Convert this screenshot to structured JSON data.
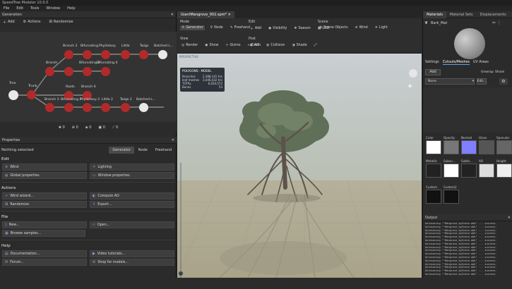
{
  "app": {
    "title": "SpeedTree Modeler 10.0.0"
  },
  "menu": [
    "File",
    "Edit",
    "Tools",
    "Window",
    "Help"
  ],
  "generation": {
    "title": "Generation",
    "tools": {
      "add": "Add",
      "actions": "Actions",
      "randomize": "Randomize"
    },
    "nodes": [
      {
        "label": "Tree"
      },
      {
        "label": "Trunk"
      },
      {
        "label": "Branch"
      },
      {
        "label": "Branch 2"
      },
      {
        "label": "Bifurcating"
      },
      {
        "label": "Phyllotaxy"
      },
      {
        "label": "Little"
      },
      {
        "label": "Twigs"
      },
      {
        "label": "Batched L..."
      },
      {
        "label": "Bifurcating 3"
      },
      {
        "label": "Bifurcating 4"
      },
      {
        "label": "Roots"
      },
      {
        "label": "Branch 4"
      },
      {
        "label": "Branch 3"
      },
      {
        "label": "Bifurcating 2"
      },
      {
        "label": "Phyllotaxy 2"
      },
      {
        "label": "Little 2"
      },
      {
        "label": "Twigs 2"
      },
      {
        "label": "Batched L..."
      }
    ],
    "stats": [
      "0",
      "0",
      "0",
      "0",
      "0"
    ]
  },
  "properties": {
    "title": "Properties",
    "nothing_selected": "Nothing selected",
    "modes": [
      "Generator",
      "Node",
      "Freehand"
    ],
    "sections": {
      "edit": "Edit",
      "actions": "Actions",
      "file": "File",
      "help": "Help"
    },
    "edit_buttons": [
      "Wind",
      "Lighting",
      "Global properties",
      "Window properties"
    ],
    "action_buttons": [
      "Wind wizard...",
      "Compute AO",
      "Randomize",
      "Export..."
    ],
    "file_buttons": [
      "New...",
      "Open...",
      "Browse samples..."
    ],
    "help_buttons": [
      "Documentation...",
      "Video tutorials...",
      "Forum...",
      "Shop for models..."
    ]
  },
  "document": {
    "tab": "GiantMangrove_002.spm*",
    "mode": {
      "label": "Mode",
      "items": [
        "Generator",
        "Node",
        "Freehand"
      ]
    },
    "edit": {
      "label": "Edit",
      "items": [
        "Add",
        "Visibility",
        "Season",
        "LOD"
      ]
    },
    "scene": {
      "label": "Scene",
      "items": [
        "Scene Objects",
        "Wind",
        "Light"
      ]
    },
    "view": {
      "label": "View",
      "items": [
        "Render",
        "Show",
        "Gizmo",
        "Zoom"
      ]
    },
    "post": {
      "label": "Post",
      "items": [
        "AO",
        "Collision",
        "Shade"
      ]
    },
    "perspective": "PERSPECTIVE",
    "stats": {
      "header": "POLYGONS · MODEL",
      "rows": [
        {
          "k": "Branches",
          "v": "2,388,141 tris"
        },
        {
          "k": "leaf meshes",
          "v": "3,446,432 tris"
        },
        {
          "k": "TOTAL",
          "v": "6,034,573"
        },
        {
          "k": "Bones",
          "v": "53"
        }
      ]
    }
  },
  "materials": {
    "tabs": [
      "Materials",
      "Material Sets",
      "Displacements"
    ],
    "name": "Bark_Mat",
    "subtabs": [
      "Settings",
      "Cutouts/Meshes",
      "UV Areas"
    ],
    "add": "Add",
    "unwrap": "Unwrap",
    "share": "Share",
    "none": "None",
    "edit": "Edit...",
    "channels": [
      "Color",
      "Opacity",
      "Normal",
      "Gloss",
      "Specular",
      "Metallic",
      "Subsu...",
      "Subfo...",
      "AO",
      "Height",
      "Custom",
      "Custom2"
    ]
  },
  "output": {
    "title": "Output",
    "lines": [
      "Autosaving \"~Mangrove_myScene.abk\" ... success.",
      "Autosaving \"~Mangrove_myScene.abk\" ... success.",
      "Autosaving \"~Mangrove_myScene.abk\" ... success.",
      "Autosaving \"~Mangrove_myScene.abk\" ... success.",
      "Autosaving \"~Mangrove_myScene.abk\" ... success.",
      "Autosaving \"~Mangrove_myScene.abk\" ... success.",
      "Autosaving \"~Mangrove_myScene.abk\" ... success.",
      "Autosaving \"~Mangrove_myScene.abk\" ... success.",
      "Autosaving \"~Mangrove_myScene.abk\" ... success.",
      "Autosaving \"~Mangrove_myScene.abk\" ... success.",
      "Autosaving \"~Mangrove_myScene.abk\" ... success.",
      "Autosaving \"~Mangrove_myScene.abk\" ... success.",
      "Autosaving \"~Mangrove_myScene.abk\" ... success.",
      "Autosaving \"~Mangrove_myScene.abk\" ... success.",
      "Autosaving \"~Mangrove_myScene.abk\" ... success.",
      "Autosaving \"~Mangrove_myScene.abk\" ... success."
    ]
  },
  "colors": {
    "accent": "#6aa0d8",
    "node": "#b02a2a"
  }
}
